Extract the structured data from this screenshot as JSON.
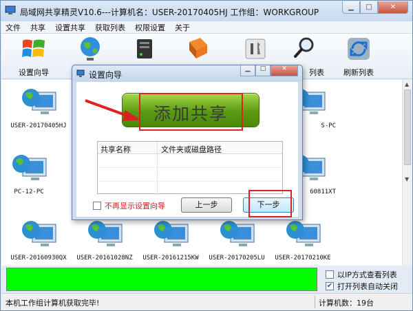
{
  "window": {
    "title": "局域网共享精灵V10.6---计算机名：USER-20170405HJ  工作组：WORKGROUP",
    "controls": {
      "minimize": "▁",
      "maximize": "□",
      "close": "✕"
    }
  },
  "menu": [
    "文件",
    "共享",
    "设置共享",
    "获取列表",
    "权限设置",
    "关于"
  ],
  "toolbar": {
    "setup_wizard": "设置向导",
    "refresh_list": "刷新列表",
    "partial_list": "列表"
  },
  "computers": [
    "USER-20170405HJ",
    "PC-12-PC",
    "USER-20160930QX",
    "USER-20161028NZ",
    "USER-20161215KW",
    "USER-20170205LU",
    "USER-20170210KE",
    "S-PC",
    "60811XT"
  ],
  "dialog": {
    "title": "设置向导",
    "add_share": "添加共享",
    "columns": [
      "共享名称",
      "文件夹或磁盘路径"
    ],
    "no_show": "不再显示设置向导",
    "prev": "上一步",
    "next": "下一步"
  },
  "options": {
    "view_by_ip": "以IP方式查看列表",
    "auto_close": "打开列表自动关闭",
    "view_by_ip_checked": false,
    "auto_close_checked": true
  },
  "status": {
    "message": "本机工作组计算机获取完毕!",
    "count": "计算机数：19台"
  },
  "colors": {
    "progress": "#00ff00",
    "highlight": "#e02020",
    "add_button": "#5a9a12"
  }
}
